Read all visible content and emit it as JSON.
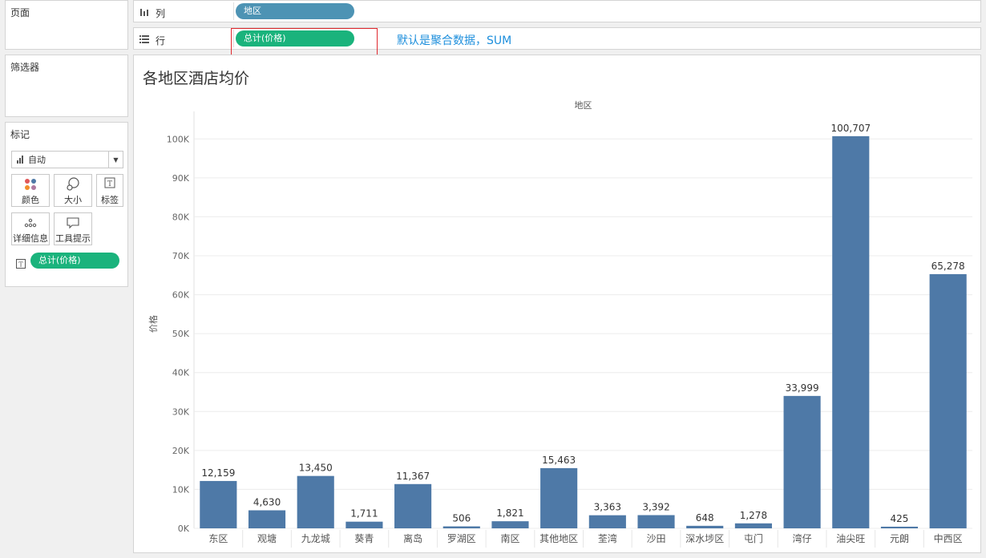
{
  "sidebar": {
    "pages_title": "页面",
    "filters_title": "筛选器",
    "marks": {
      "title": "标记",
      "mark_type": "自动",
      "buttons": [
        {
          "label": "颜色",
          "icon": "color-dots-icon"
        },
        {
          "label": "大小",
          "icon": "size-icon"
        },
        {
          "label": "标签",
          "icon": "label-icon"
        },
        {
          "label": "详细信息",
          "icon": "detail-icon"
        },
        {
          "label": "工具提示",
          "icon": "tooltip-icon"
        }
      ],
      "label_pill": "总计(价格)"
    }
  },
  "shelves": {
    "columns": {
      "icon": "columns-icon",
      "label": "列",
      "pill": "地区"
    },
    "rows": {
      "icon": "rows-icon",
      "label": "行",
      "pill": "总计(价格)"
    }
  },
  "annotation": "默认是聚合数据，SUM",
  "colors": {
    "bar": "#4e79a7",
    "pill_measure": "#1ab37c",
    "pill_dimension": "#4d93b4",
    "annotation": "#1e8fdc",
    "highlight": "#e0282e"
  },
  "view": {
    "title": "各地区酒店均价"
  },
  "chart_data": {
    "type": "bar",
    "title": "各地区酒店均价",
    "column_header": "地区",
    "ylabel": "价格",
    "xlabel": "",
    "ylim": [
      0,
      105000
    ],
    "y_ticks": [
      {
        "value": 0,
        "label": "0K"
      },
      {
        "value": 10000,
        "label": "10K"
      },
      {
        "value": 20000,
        "label": "20K"
      },
      {
        "value": 30000,
        "label": "30K"
      },
      {
        "value": 40000,
        "label": "40K"
      },
      {
        "value": 50000,
        "label": "50K"
      },
      {
        "value": 60000,
        "label": "60K"
      },
      {
        "value": 70000,
        "label": "70K"
      },
      {
        "value": 80000,
        "label": "80K"
      },
      {
        "value": 90000,
        "label": "90K"
      },
      {
        "value": 100000,
        "label": "100K"
      }
    ],
    "categories": [
      "东区",
      "观塘",
      "九龙城",
      "葵青",
      "离岛",
      "罗湖区",
      "南区",
      "其他地区",
      "荃湾",
      "沙田",
      "深水埗区",
      "屯门",
      "湾仔",
      "油尖旺",
      "元朗",
      "中西区"
    ],
    "values": [
      12159,
      4630,
      13450,
      1711,
      11367,
      506,
      1821,
      15463,
      3363,
      3392,
      648,
      1278,
      33999,
      100707,
      425,
      65278
    ],
    "value_labels": [
      "12,159",
      "4,630",
      "13,450",
      "1,711",
      "11,367",
      "506",
      "1,821",
      "15,463",
      "3,363",
      "3,392",
      "648",
      "1,278",
      "33,999",
      "100,707",
      "425",
      "65,278"
    ],
    "grid": true,
    "legend": "none"
  }
}
